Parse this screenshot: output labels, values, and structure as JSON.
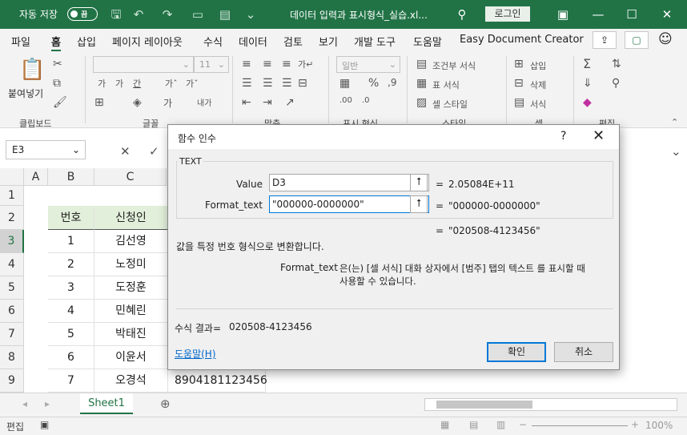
{
  "titlebar": {
    "autosave_label": "자동 저장",
    "autosave_toggle": "끔",
    "document_title": "데이터 입력과 표시형식_실습.xl...",
    "login_label": "로그인"
  },
  "tabs": [
    "파일",
    "홈",
    "삽입",
    "페이지 레이아웃",
    "수식",
    "데이터",
    "검토",
    "보기",
    "개발 도구",
    "도움말",
    "Easy Document Creator"
  ],
  "ribbon": {
    "paste_label": "붙여넣기",
    "font_size": "11",
    "number_format": "일반",
    "groups": [
      "클립보드",
      "글꼴",
      "맞춤",
      "표시 형식",
      "스타일",
      "셀",
      "편집"
    ],
    "style_items": [
      "조건부 서식",
      "표 서식",
      "셀 스타일"
    ],
    "cell_items": [
      "삽입",
      "삭제",
      "서식"
    ]
  },
  "namebox": {
    "value": "E3"
  },
  "columns": [
    "A",
    "B",
    "C"
  ],
  "rows": [
    "1",
    "2",
    "3",
    "4",
    "5",
    "6",
    "7",
    "8",
    "9"
  ],
  "table": {
    "header": [
      "번호",
      "신청인"
    ],
    "data": [
      [
        "1",
        "김선영"
      ],
      [
        "2",
        "노정미"
      ],
      [
        "3",
        "도정훈"
      ],
      [
        "4",
        "민혜린"
      ],
      [
        "5",
        "박태진"
      ],
      [
        "6",
        "이윤서"
      ],
      [
        "7",
        "오경석"
      ]
    ],
    "visible_d9": "8904181123456"
  },
  "sheet": {
    "tab_name": "Sheet1"
  },
  "statusbar": {
    "mode": "편집",
    "zoom": "100%"
  },
  "dialog": {
    "title": "함수 인수",
    "help_glyph": "?",
    "function_name": "TEXT",
    "args": [
      {
        "label": "Value",
        "value": "D3",
        "result": "2.05084E+11"
      },
      {
        "label": "Format_text",
        "value": "\"000000-0000000\"",
        "result": "\"000000-0000000\""
      }
    ],
    "equals": "=",
    "overall_result": "\"020508-4123456\"",
    "description": "값을 특정 번호 형식으로 변환합니다.",
    "arg_help_name": "Format_text",
    "arg_help_text_1": "은(는) [셀 서식] 대화 상자에서 [범주] 탭의 텍스트 를 표시할 때",
    "arg_help_text_2": "사용할 수 있습니다.",
    "formula_result_label": "수식 결과=",
    "formula_result_value": "020508-4123456",
    "help_link": "도움말(H)",
    "ok_label": "확인",
    "cancel_label": "취소"
  }
}
